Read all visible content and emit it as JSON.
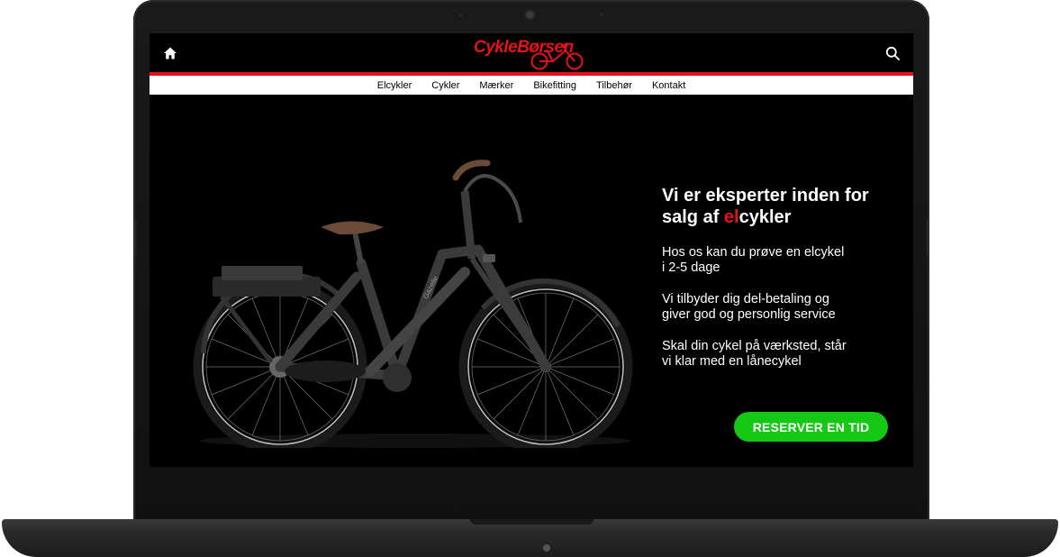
{
  "header": {
    "logo_text": "CykleBørsen",
    "home_icon": "home-icon",
    "search_icon": "search-icon",
    "accent_color": "#e3121b"
  },
  "nav": {
    "items": [
      {
        "label": "Elcykler"
      },
      {
        "label": "Cykler"
      },
      {
        "label": "Mærker"
      },
      {
        "label": "Bikefitting"
      },
      {
        "label": "Tilbehør"
      },
      {
        "label": "Kontakt"
      }
    ]
  },
  "hero": {
    "headline_part1": "Vi er eksperter inden for",
    "headline_part2": "salg af ",
    "headline_highlight": "el",
    "headline_part3": "cykler",
    "para1_line1": "Hos os kan du prøve en elcykel",
    "para1_line2": "i 2-5 dage",
    "para2_line1": "Vi tilbyder dig del-betaling og",
    "para2_line2": "giver god og personlig service",
    "para3_line1": "Skal din cykel på værksted, står",
    "para3_line2": "vi klar med en lånecykel",
    "cta_label": "RESERVER EN TID",
    "cta_color": "#14c814",
    "bike_brand": "Gazelle"
  }
}
